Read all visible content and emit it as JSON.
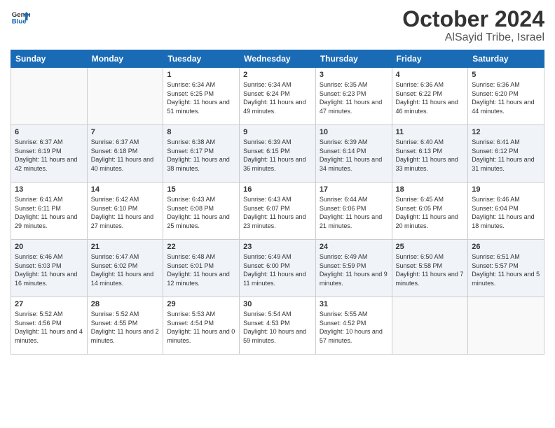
{
  "logo": {
    "line1": "General",
    "line2": "Blue"
  },
  "title": "October 2024",
  "subtitle": "AlSayid Tribe, Israel",
  "days_header": [
    "Sunday",
    "Monday",
    "Tuesday",
    "Wednesday",
    "Thursday",
    "Friday",
    "Saturday"
  ],
  "weeks": [
    [
      {
        "num": "",
        "info": ""
      },
      {
        "num": "",
        "info": ""
      },
      {
        "num": "1",
        "info": "Sunrise: 6:34 AM\nSunset: 6:25 PM\nDaylight: 11 hours and 51 minutes."
      },
      {
        "num": "2",
        "info": "Sunrise: 6:34 AM\nSunset: 6:24 PM\nDaylight: 11 hours and 49 minutes."
      },
      {
        "num": "3",
        "info": "Sunrise: 6:35 AM\nSunset: 6:23 PM\nDaylight: 11 hours and 47 minutes."
      },
      {
        "num": "4",
        "info": "Sunrise: 6:36 AM\nSunset: 6:22 PM\nDaylight: 11 hours and 46 minutes."
      },
      {
        "num": "5",
        "info": "Sunrise: 6:36 AM\nSunset: 6:20 PM\nDaylight: 11 hours and 44 minutes."
      }
    ],
    [
      {
        "num": "6",
        "info": "Sunrise: 6:37 AM\nSunset: 6:19 PM\nDaylight: 11 hours and 42 minutes."
      },
      {
        "num": "7",
        "info": "Sunrise: 6:37 AM\nSunset: 6:18 PM\nDaylight: 11 hours and 40 minutes."
      },
      {
        "num": "8",
        "info": "Sunrise: 6:38 AM\nSunset: 6:17 PM\nDaylight: 11 hours and 38 minutes."
      },
      {
        "num": "9",
        "info": "Sunrise: 6:39 AM\nSunset: 6:15 PM\nDaylight: 11 hours and 36 minutes."
      },
      {
        "num": "10",
        "info": "Sunrise: 6:39 AM\nSunset: 6:14 PM\nDaylight: 11 hours and 34 minutes."
      },
      {
        "num": "11",
        "info": "Sunrise: 6:40 AM\nSunset: 6:13 PM\nDaylight: 11 hours and 33 minutes."
      },
      {
        "num": "12",
        "info": "Sunrise: 6:41 AM\nSunset: 6:12 PM\nDaylight: 11 hours and 31 minutes."
      }
    ],
    [
      {
        "num": "13",
        "info": "Sunrise: 6:41 AM\nSunset: 6:11 PM\nDaylight: 11 hours and 29 minutes."
      },
      {
        "num": "14",
        "info": "Sunrise: 6:42 AM\nSunset: 6:10 PM\nDaylight: 11 hours and 27 minutes."
      },
      {
        "num": "15",
        "info": "Sunrise: 6:43 AM\nSunset: 6:08 PM\nDaylight: 11 hours and 25 minutes."
      },
      {
        "num": "16",
        "info": "Sunrise: 6:43 AM\nSunset: 6:07 PM\nDaylight: 11 hours and 23 minutes."
      },
      {
        "num": "17",
        "info": "Sunrise: 6:44 AM\nSunset: 6:06 PM\nDaylight: 11 hours and 21 minutes."
      },
      {
        "num": "18",
        "info": "Sunrise: 6:45 AM\nSunset: 6:05 PM\nDaylight: 11 hours and 20 minutes."
      },
      {
        "num": "19",
        "info": "Sunrise: 6:46 AM\nSunset: 6:04 PM\nDaylight: 11 hours and 18 minutes."
      }
    ],
    [
      {
        "num": "20",
        "info": "Sunrise: 6:46 AM\nSunset: 6:03 PM\nDaylight: 11 hours and 16 minutes."
      },
      {
        "num": "21",
        "info": "Sunrise: 6:47 AM\nSunset: 6:02 PM\nDaylight: 11 hours and 14 minutes."
      },
      {
        "num": "22",
        "info": "Sunrise: 6:48 AM\nSunset: 6:01 PM\nDaylight: 11 hours and 12 minutes."
      },
      {
        "num": "23",
        "info": "Sunrise: 6:49 AM\nSunset: 6:00 PM\nDaylight: 11 hours and 11 minutes."
      },
      {
        "num": "24",
        "info": "Sunrise: 6:49 AM\nSunset: 5:59 PM\nDaylight: 11 hours and 9 minutes."
      },
      {
        "num": "25",
        "info": "Sunrise: 6:50 AM\nSunset: 5:58 PM\nDaylight: 11 hours and 7 minutes."
      },
      {
        "num": "26",
        "info": "Sunrise: 6:51 AM\nSunset: 5:57 PM\nDaylight: 11 hours and 5 minutes."
      }
    ],
    [
      {
        "num": "27",
        "info": "Sunrise: 5:52 AM\nSunset: 4:56 PM\nDaylight: 11 hours and 4 minutes."
      },
      {
        "num": "28",
        "info": "Sunrise: 5:52 AM\nSunset: 4:55 PM\nDaylight: 11 hours and 2 minutes."
      },
      {
        "num": "29",
        "info": "Sunrise: 5:53 AM\nSunset: 4:54 PM\nDaylight: 11 hours and 0 minutes."
      },
      {
        "num": "30",
        "info": "Sunrise: 5:54 AM\nSunset: 4:53 PM\nDaylight: 10 hours and 59 minutes."
      },
      {
        "num": "31",
        "info": "Sunrise: 5:55 AM\nSunset: 4:52 PM\nDaylight: 10 hours and 57 minutes."
      },
      {
        "num": "",
        "info": ""
      },
      {
        "num": "",
        "info": ""
      }
    ]
  ]
}
